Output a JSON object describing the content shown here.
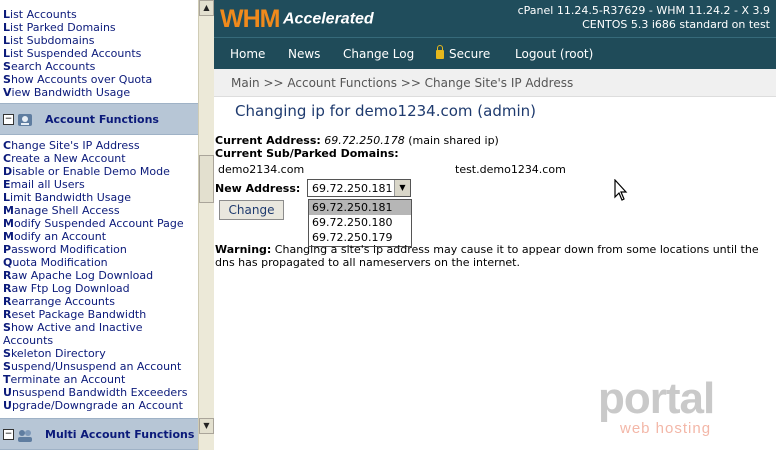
{
  "sidebar": {
    "top_links": [
      {
        "first": "L",
        "rest": "ist Accounts"
      },
      {
        "first": "L",
        "rest": "ist Parked Domains"
      },
      {
        "first": "L",
        "rest": "ist Subdomains"
      },
      {
        "first": "L",
        "rest": "ist Suspended Accounts"
      },
      {
        "first": "S",
        "rest": "earch Accounts"
      },
      {
        "first": "S",
        "rest": "how Accounts over Quota"
      },
      {
        "first": "V",
        "rest": "iew Bandwidth Usage"
      }
    ],
    "section_account_functions": {
      "toggle": "−",
      "title": "Account Functions"
    },
    "account_links": [
      {
        "first": "C",
        "rest": "hange Site's IP Address"
      },
      {
        "first": "C",
        "rest": "reate a New Account"
      },
      {
        "first": "D",
        "rest": "isable or Enable Demo Mode"
      },
      {
        "first": "E",
        "rest": "mail all Users"
      },
      {
        "first": "L",
        "rest": "imit Bandwidth Usage"
      },
      {
        "first": "M",
        "rest": "anage Shell Access"
      },
      {
        "first": "M",
        "rest": "odify Suspended Account Page"
      },
      {
        "first": "M",
        "rest": "odify an Account"
      },
      {
        "first": "P",
        "rest": "assword Modification"
      },
      {
        "first": "Q",
        "rest": "uota Modification"
      },
      {
        "first": "R",
        "rest": "aw Apache Log Download"
      },
      {
        "first": "R",
        "rest": "aw Ftp Log Download"
      },
      {
        "first": "R",
        "rest": "earrange Accounts"
      },
      {
        "first": "R",
        "rest": "eset Package Bandwidth"
      },
      {
        "first": "S",
        "rest": "how Active and Inactive"
      },
      {
        "first": "",
        "rest": "Accounts"
      },
      {
        "first": "S",
        "rest": "keleton Directory"
      },
      {
        "first": "S",
        "rest": "uspend/Unsuspend an Account"
      },
      {
        "first": "T",
        "rest": "erminate an Account"
      },
      {
        "first": "U",
        "rest": "nsuspend Bandwidth Exceeders"
      },
      {
        "first": "U",
        "rest": "pgrade/Downgrade an Account"
      }
    ],
    "section_multi_account": {
      "toggle": "−",
      "title": "Multi Account Functions"
    }
  },
  "header": {
    "logo_main": "WHM",
    "logo_sub": "Accelerated",
    "version_line1": "cPanel 11.24.5-R37629 - WHM 11.24.2 - X 3.9",
    "version_line2": "CENTOS 5.3 i686 standard on test"
  },
  "nav": {
    "home": "Home",
    "news": "News",
    "changelog": "Change Log",
    "secure": "Secure",
    "logout": "Logout (root)"
  },
  "breadcrumb": "Main >> Account Functions >> Change Site's IP Address",
  "page_title": "Changing ip for demo1234.com (admin)",
  "form": {
    "current_address_label": "Current Address:",
    "current_address_value": "69.72.250.178",
    "current_address_note": "(main shared ip)",
    "subdomains_label": "Current Sub/Parked Domains:",
    "domain_1": "demo2134.com",
    "domain_2": "test.demo1234.com",
    "new_address_label": "New Address:",
    "selected_ip": "69.72.250.181",
    "ip_options": [
      "69.72.250.181",
      "69.72.250.180",
      "69.72.250.179"
    ],
    "change_button": "Change",
    "warning_label": "Warning:",
    "warning_text": "Changing a site's ip address may cause it to appear down from some locations until the dns has propagated to all nameservers on the internet."
  },
  "watermark": {
    "brand": "portal",
    "tagline": "web hosting"
  },
  "colors": {
    "topbar": "#204d5c",
    "logo_accent": "#f08a1c",
    "sidebar_link": "#0b1a7a",
    "section_header": "#b7c6d6"
  }
}
